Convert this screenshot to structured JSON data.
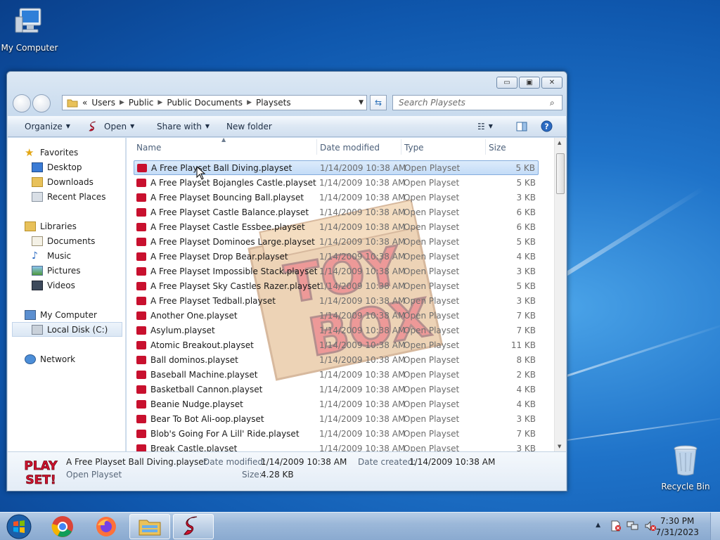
{
  "desktop": {
    "icons": {
      "my_computer": "My Computer",
      "recycle_bin": "Recycle Bin"
    }
  },
  "window": {
    "caption_buttons": {
      "minimize": "▭",
      "maximize": "▣",
      "close": "✕"
    },
    "address": {
      "prefix": "«",
      "crumbs": [
        "Users",
        "Public",
        "Public Documents",
        "Playsets"
      ]
    },
    "search_placeholder": "Search Playsets",
    "toolbar": {
      "organize": "Organize",
      "open": "Open",
      "share_with": "Share with",
      "new_folder": "New folder"
    },
    "nav": {
      "favorites": "Favorites",
      "desktop": "Desktop",
      "downloads": "Downloads",
      "recent_places": "Recent Places",
      "libraries": "Libraries",
      "documents": "Documents",
      "music": "Music",
      "pictures": "Pictures",
      "videos": "Videos",
      "my_computer": "My Computer",
      "local_disk": "Local Disk (C:)",
      "network": "Network"
    },
    "columns": {
      "name": "Name",
      "date": "Date modified",
      "type": "Type",
      "size": "Size"
    },
    "files": [
      {
        "name": "A Free Playset Ball Diving.playset",
        "date": "1/14/2009 10:38 AM",
        "type": "Open Playset",
        "size": "5 KB"
      },
      {
        "name": "A Free Playset Bojangles Castle.playset",
        "date": "1/14/2009 10:38 AM",
        "type": "Open Playset",
        "size": "5 KB"
      },
      {
        "name": "A Free Playset Bouncing Ball.playset",
        "date": "1/14/2009 10:38 AM",
        "type": "Open Playset",
        "size": "3 KB"
      },
      {
        "name": "A Free Playset Castle Balance.playset",
        "date": "1/14/2009 10:38 AM",
        "type": "Open Playset",
        "size": "6 KB"
      },
      {
        "name": "A Free Playset Castle Essbee.playset",
        "date": "1/14/2009 10:38 AM",
        "type": "Open Playset",
        "size": "6 KB"
      },
      {
        "name": "A Free Playset Dominoes Large.playset",
        "date": "1/14/2009 10:38 AM",
        "type": "Open Playset",
        "size": "5 KB"
      },
      {
        "name": "A Free Playset Drop Bear.playset",
        "date": "1/14/2009 10:38 AM",
        "type": "Open Playset",
        "size": "4 KB"
      },
      {
        "name": "A Free Playset Impossible Stack.playset",
        "date": "1/14/2009 10:38 AM",
        "type": "Open Playset",
        "size": "3 KB"
      },
      {
        "name": "A Free Playset Sky Castles Razer.playset",
        "date": "1/14/2009 10:38 AM",
        "type": "Open Playset",
        "size": "5 KB"
      },
      {
        "name": "A Free Playset Tedball.playset",
        "date": "1/14/2009 10:38 AM",
        "type": "Open Playset",
        "size": "3 KB"
      },
      {
        "name": "Another One.playset",
        "date": "1/14/2009 10:38 AM",
        "type": "Open Playset",
        "size": "7 KB"
      },
      {
        "name": "Asylum.playset",
        "date": "1/14/2009 10:38 AM",
        "type": "Open Playset",
        "size": "7 KB"
      },
      {
        "name": "Atomic Breakout.playset",
        "date": "1/14/2009 10:38 AM",
        "type": "Open Playset",
        "size": "11 KB"
      },
      {
        "name": "Ball dominos.playset",
        "date": "1/14/2009 10:38 AM",
        "type": "Open Playset",
        "size": "8 KB"
      },
      {
        "name": "Baseball Machine.playset",
        "date": "1/14/2009 10:38 AM",
        "type": "Open Playset",
        "size": "2 KB"
      },
      {
        "name": "Basketball Cannon.playset",
        "date": "1/14/2009 10:38 AM",
        "type": "Open Playset",
        "size": "4 KB"
      },
      {
        "name": "Beanie Nudge.playset",
        "date": "1/14/2009 10:38 AM",
        "type": "Open Playset",
        "size": "4 KB"
      },
      {
        "name": "Bear To Bot Ali-oop.playset",
        "date": "1/14/2009 10:38 AM",
        "type": "Open Playset",
        "size": "3 KB"
      },
      {
        "name": "Blob's Going For A Lill' Ride.playset",
        "date": "1/14/2009 10:38 AM",
        "type": "Open Playset",
        "size": "7 KB"
      },
      {
        "name": "Break Castle.playset",
        "date": "1/14/2009 10:38 AM",
        "type": "Open Playset",
        "size": "3 KB"
      }
    ],
    "watermark_text": [
      "TOY",
      "BOX"
    ],
    "details": {
      "logo_text": [
        "PLAY",
        "SET!"
      ],
      "file_name": "A Free Playset Ball Diving.playset",
      "file_type": "Open Playset",
      "date_modified_label": "Date modified:",
      "date_modified": "1/14/2009 10:38 AM",
      "date_created_label": "Date created:",
      "date_created": "1/14/2009 10:38 AM",
      "size_label": "Size:",
      "size": "4.28 KB"
    }
  },
  "taskbar": {
    "clock_time": "7:30 PM",
    "clock_date": "7/31/2023"
  },
  "colors": {
    "accent_red": "#c8102e",
    "selection_blue": "#c4dcf7",
    "taskbar": "#9cb8d9"
  }
}
